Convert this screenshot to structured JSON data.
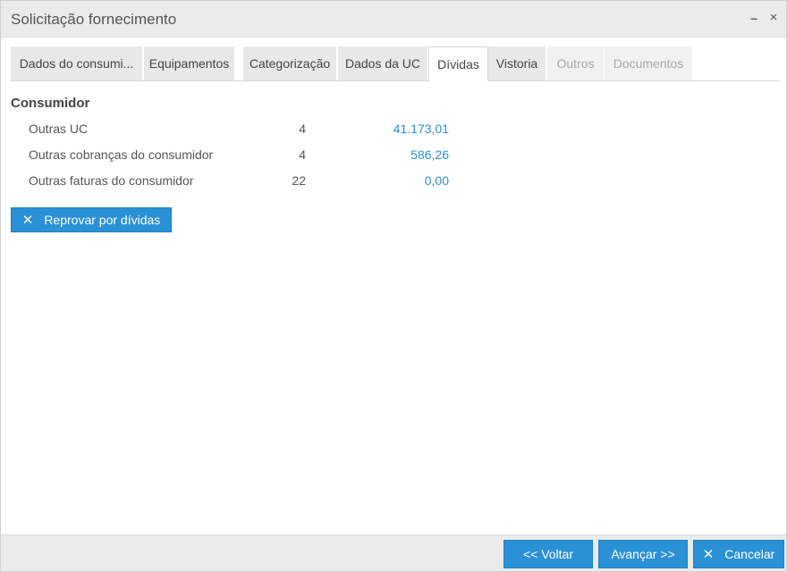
{
  "window": {
    "title": "Solicitação fornecimento",
    "minimize_glyph": "–",
    "close_glyph": "×"
  },
  "tabs": [
    {
      "label": "Dados do consumi...",
      "state": "normal"
    },
    {
      "label": "Equipamentos",
      "state": "normal"
    },
    {
      "label": "Categorização",
      "state": "normal"
    },
    {
      "label": "Dados da UC",
      "state": "normal"
    },
    {
      "label": "Dívidas",
      "state": "active"
    },
    {
      "label": "Vistoria",
      "state": "normal"
    },
    {
      "label": "Outros",
      "state": "disabled"
    },
    {
      "label": "Documentos",
      "state": "disabled"
    }
  ],
  "consumidor": {
    "title": "Consumidor",
    "rows": [
      {
        "label": "Outras UC",
        "count": "4",
        "value": "41.173,01"
      },
      {
        "label": "Outras cobranças do consumidor",
        "count": "4",
        "value": "586,26"
      },
      {
        "label": "Outras faturas do consumidor",
        "count": "22",
        "value": "0,00"
      }
    ],
    "reprovar_label": "Reprovar por dívidas",
    "reprovar_icon": "close-icon"
  },
  "footer": {
    "voltar_label": "<< Voltar",
    "avancar_label": "Avançar >>",
    "cancelar_label": "Cancelar",
    "cancelar_icon": "close-icon"
  },
  "colors": {
    "accent": "#2b91d7",
    "link_value": "#2a8fd4",
    "tab_bg": "#e8e8e8",
    "bar_bg": "#ebebeb"
  }
}
